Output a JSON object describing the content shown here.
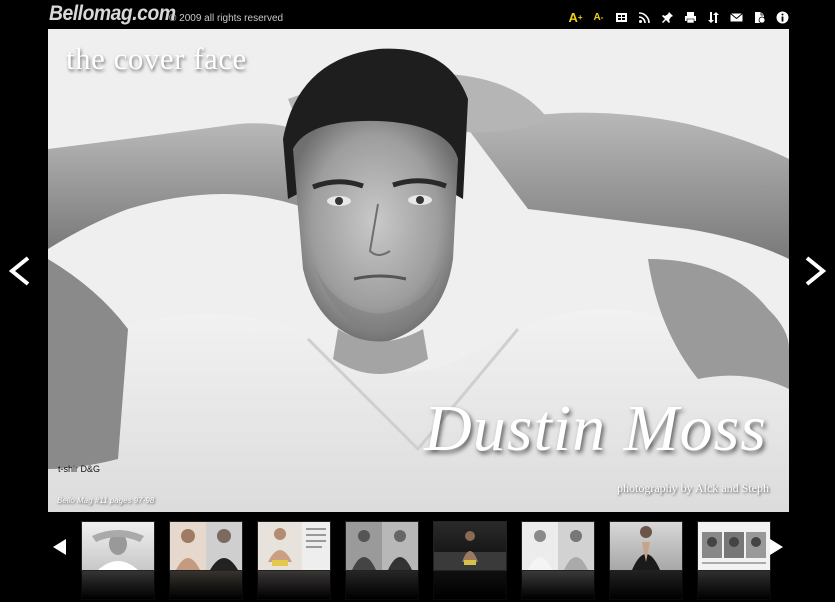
{
  "header": {
    "logo": "Bellomag.com",
    "copyright": "© 2009 all rights reserved"
  },
  "toolbar": {
    "icons": [
      "font-increase-icon",
      "font-decrease-icon",
      "view-icon",
      "rss-icon",
      "pin-icon",
      "print-icon",
      "share-icon",
      "email-icon",
      "language-icon",
      "info-icon"
    ],
    "font_increase": "A",
    "font_decrease": "A",
    "font_increase_sup": "+",
    "font_decrease_sup": "-"
  },
  "viewer": {
    "cover_label": "the cover face",
    "model_name": "Dustin Moss",
    "credit": "photography by Alck and Steph",
    "tshirt_note": "t-shir D&G",
    "pages_note": "Bello Mag #11 pages 97-98"
  },
  "accent_color": "#f1d21a",
  "thumbnails": [
    {
      "id": 1,
      "style": "bw-light"
    },
    {
      "id": 2,
      "style": "color-pair"
    },
    {
      "id": 3,
      "style": "color-page"
    },
    {
      "id": 4,
      "style": "bw-pair"
    },
    {
      "id": 5,
      "style": "dark-beach"
    },
    {
      "id": 6,
      "style": "light-pair"
    },
    {
      "id": 7,
      "style": "dark-suit"
    },
    {
      "id": 8,
      "style": "collage-page"
    }
  ]
}
